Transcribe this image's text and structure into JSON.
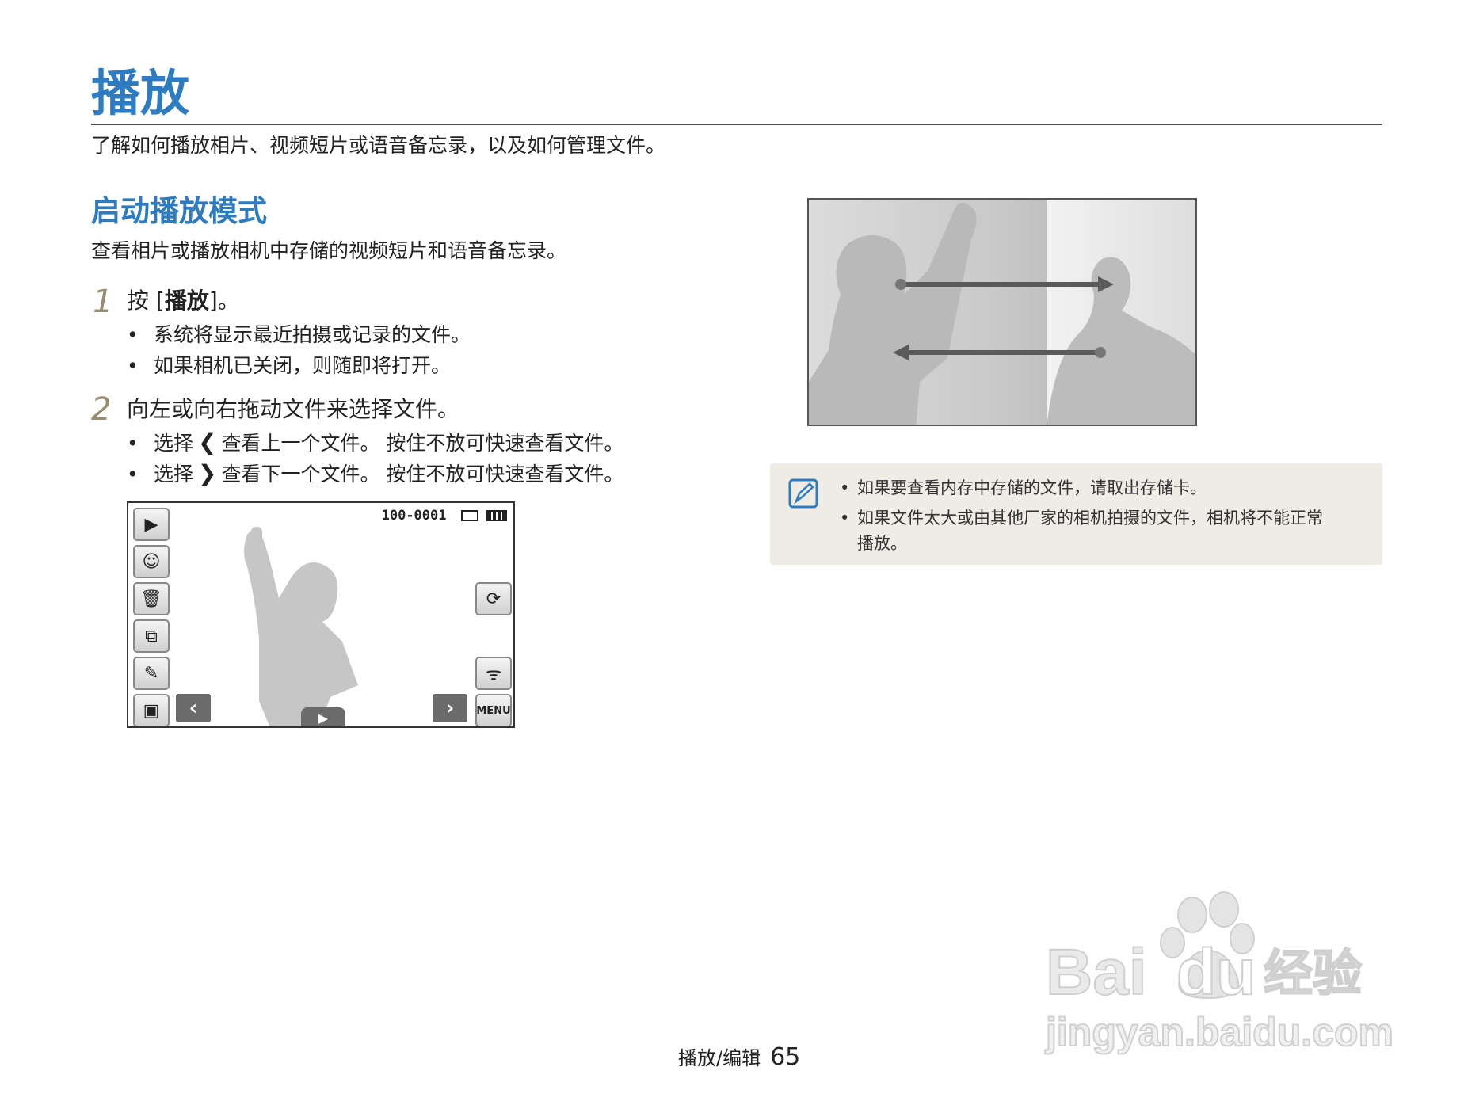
{
  "header": {
    "title": "播放",
    "intro": "了解如何播放相片、视频短片或语音备忘录，以及如何管理文件。"
  },
  "section": {
    "heading": "启动播放模式",
    "description": "查看相片或播放相机中存储的视频短片和语音备忘录。"
  },
  "steps": [
    {
      "number": "1",
      "text_prefix": "按 [",
      "text_bold": "播放",
      "text_suffix": "]。",
      "bullets": [
        "系统将显示最近拍摄或记录的文件。",
        "如果相机已关闭，则随即将打开。"
      ]
    },
    {
      "number": "2",
      "text": "向左或向右拖动文件来选择文件。",
      "bullets": [
        {
          "pre": "选择",
          "icon": "❮",
          "post": "查看上一个文件。 按住不放可快速查看文件。"
        },
        {
          "pre": "选择",
          "icon": "❯",
          "post": "查看下一个文件。 按住不放可快速查看文件。"
        }
      ]
    }
  ],
  "camera_screen": {
    "file_number": "100-0001",
    "menu_label": "MENU",
    "left_icons": [
      "playback-icon",
      "face-recognition-icon",
      "trash-icon",
      "slideshow-icon",
      "edit-icon",
      "display-icon"
    ],
    "right_icons": [
      "rotate-icon",
      "wireless-icon",
      "menu-icon"
    ]
  },
  "note": {
    "icon": "note-pencil-icon",
    "bullets": [
      "如果要查看内存中存储的文件，请取出存储卡。",
      "如果文件太大或由其他厂家的相机拍摄的文件，相机将不能正常",
      "播放。"
    ]
  },
  "footer": {
    "section": "播放/编辑",
    "page_number": "65"
  },
  "watermark": {
    "brand": "Bai du 经验",
    "url": "jingyan.baidu.com"
  },
  "colors": {
    "accent": "#2d7cc2",
    "step_number": "#9a8c6e",
    "note_bg": "#efebe5"
  }
}
